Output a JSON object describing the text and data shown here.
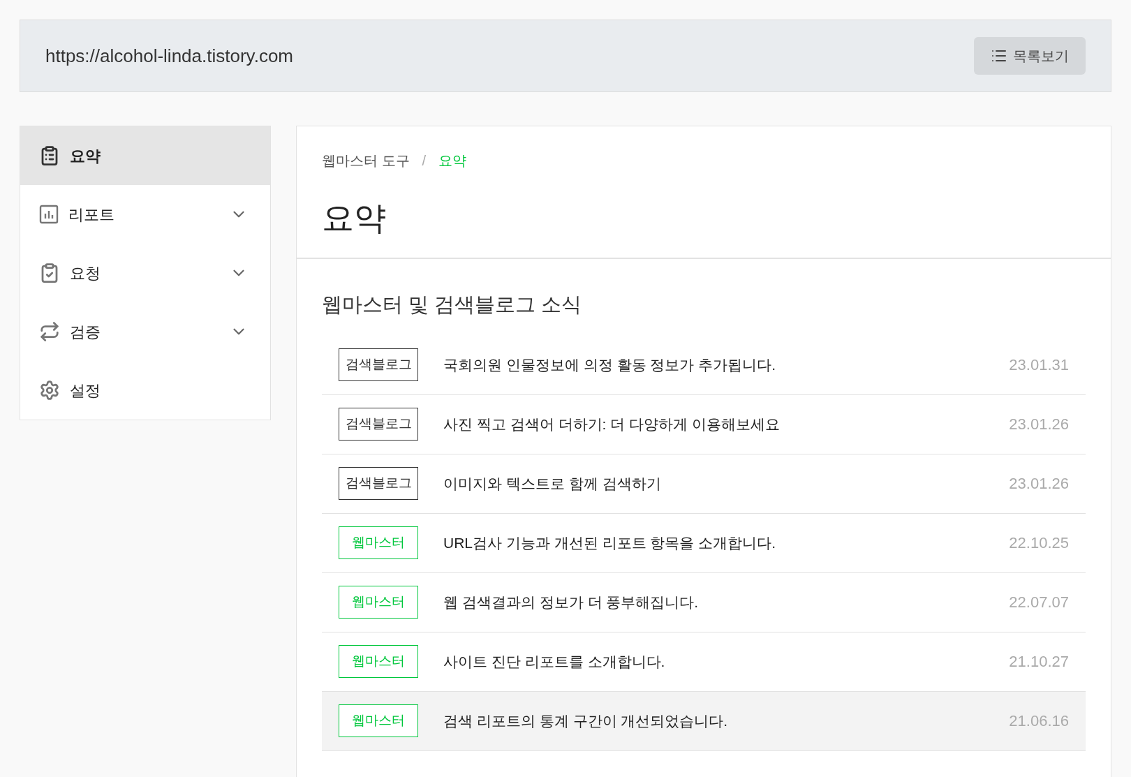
{
  "header": {
    "url": "https://alcohol-linda.tistory.com",
    "list_button": "목록보기"
  },
  "sidebar": {
    "items": [
      {
        "label": "요약",
        "selected": true,
        "expandable": false
      },
      {
        "label": "리포트",
        "selected": false,
        "expandable": true
      },
      {
        "label": "요청",
        "selected": false,
        "expandable": true
      },
      {
        "label": "검증",
        "selected": false,
        "expandable": true
      },
      {
        "label": "설정",
        "selected": false,
        "expandable": false
      }
    ]
  },
  "breadcrumb": [
    {
      "label": "웹마스터 도구",
      "selected": false
    },
    {
      "label": "/",
      "selected": false
    },
    {
      "label": "요약",
      "selected": true
    }
  ],
  "title": "요약",
  "news": {
    "heading": "웹마스터 및 검색블로그 소식",
    "rows": [
      {
        "tag": "검색블로그",
        "color": "#333333",
        "title": "국회의원 인물정보에 의정 활동 정보가 추가됩니다.",
        "date": "23.01.31",
        "highlighted": false
      },
      {
        "tag": "검색블로그",
        "color": "#333333",
        "title": "사진 찍고 검색어 더하기: 더 다양하게 이용해보세요",
        "date": "23.01.26",
        "highlighted": false
      },
      {
        "tag": "검색블로그",
        "color": "#333333",
        "title": "이미지와 텍스트로 함께 검색하기",
        "date": "23.01.26",
        "highlighted": false
      },
      {
        "tag": "웹마스터",
        "color": "#00c73c",
        "title": "URL검사 기능과 개선된 리포트 항목을 소개합니다.",
        "date": "22.10.25",
        "highlighted": false
      },
      {
        "tag": "웹마스터",
        "color": "#00c73c",
        "title": "웹 검색결과의 정보가 더 풍부해집니다.",
        "date": "22.07.07",
        "highlighted": false
      },
      {
        "tag": "웹마스터",
        "color": "#00c73c",
        "title": "사이트 진단 리포트를 소개합니다.",
        "date": "21.10.27",
        "highlighted": false
      },
      {
        "tag": "웹마스터",
        "color": "#00c73c",
        "title": "검색 리포트의 통계 구간이 개선되었습니다.",
        "date": "21.06.16",
        "highlighted": true
      }
    ]
  }
}
